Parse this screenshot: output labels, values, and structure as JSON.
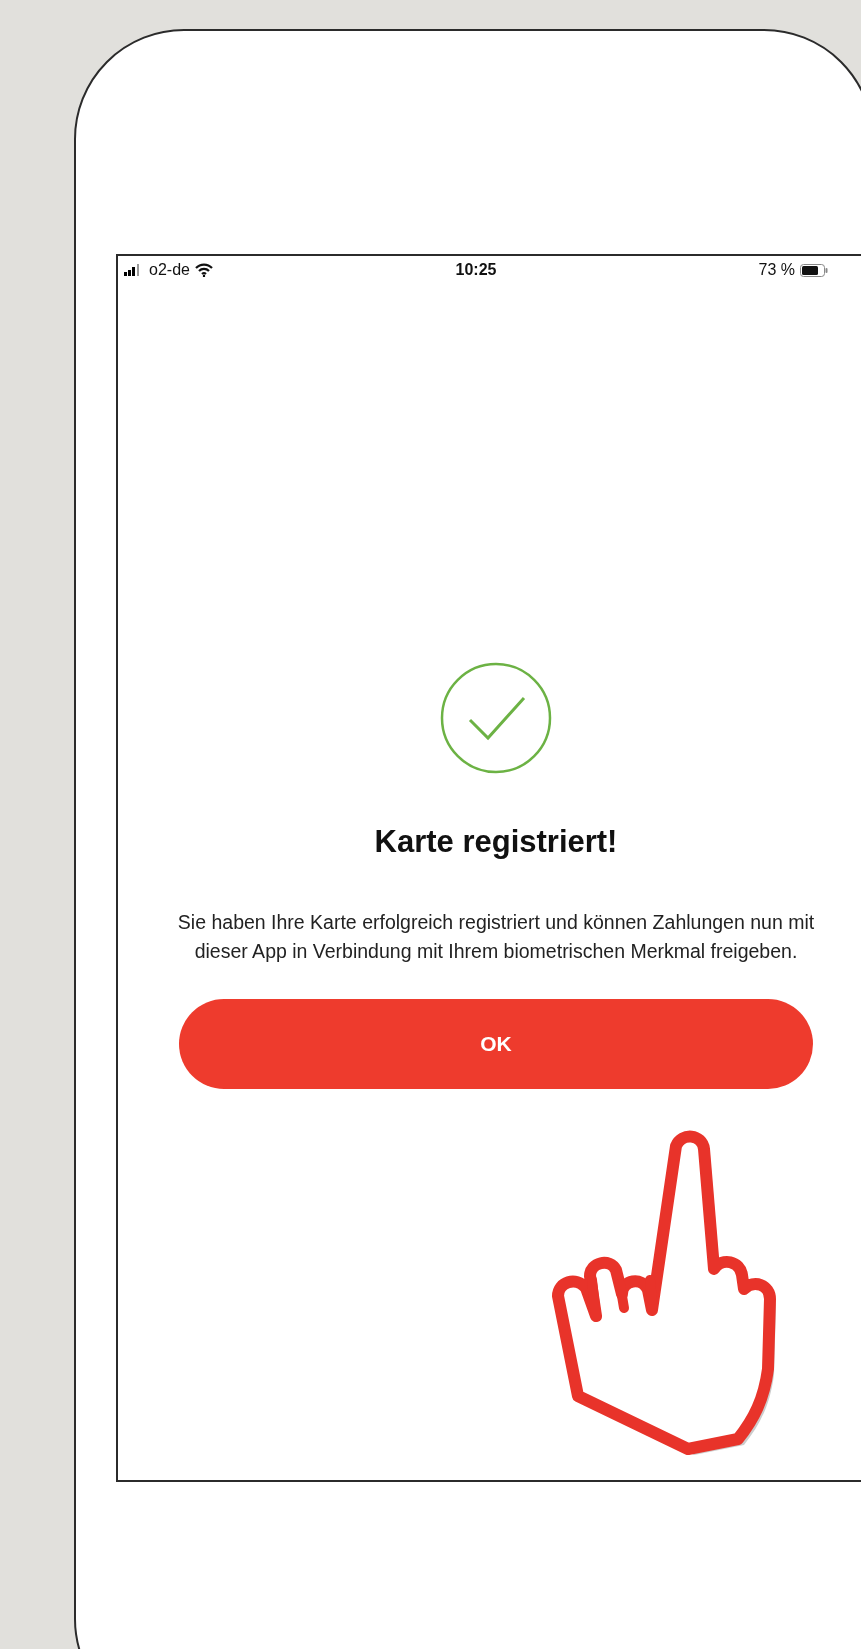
{
  "status_bar": {
    "carrier": "o2-de",
    "time": "10:25",
    "battery": "73 %"
  },
  "confirmation": {
    "title": "Karte registriert!",
    "message": "Sie haben Ihre Karte erfolgreich registriert und können Zahlungen nun mit dieser App in Verbindung mit Ihrem biometrischen Merkmal freigeben.",
    "button": "OK"
  }
}
